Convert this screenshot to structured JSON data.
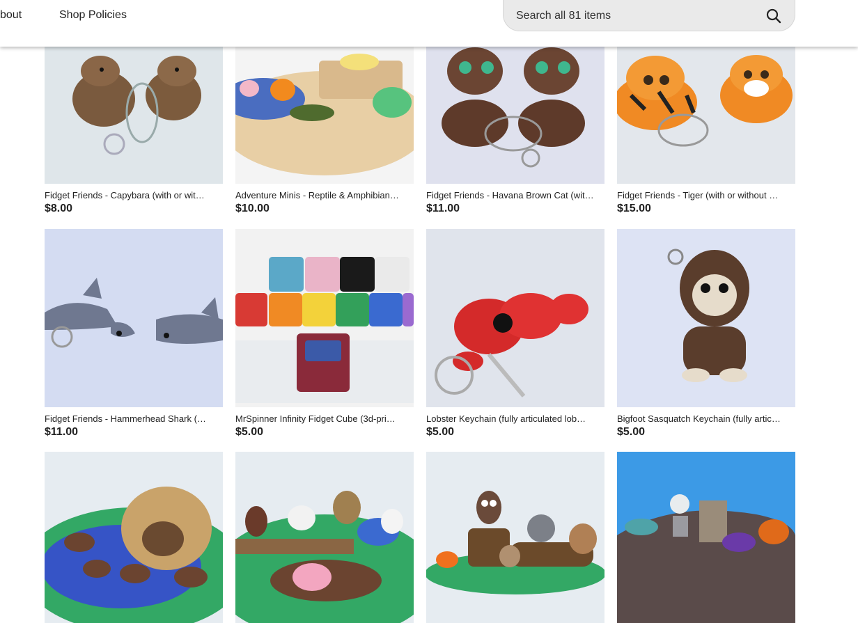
{
  "header": {
    "nav": [
      {
        "label": "bout"
      },
      {
        "label": "Shop Policies"
      }
    ],
    "search": {
      "placeholder": "Search all 81 items",
      "icon": "search-icon"
    }
  },
  "listings": [
    {
      "title": "Fidget Friends - Capybara (with or wit…",
      "price": "$8.00"
    },
    {
      "title": "Adventure Minis - Reptile & Amphibian…",
      "price": "$10.00"
    },
    {
      "title": "Fidget Friends - Havana Brown Cat (wit…",
      "price": "$11.00"
    },
    {
      "title": "Fidget Friends - Tiger (with or without …",
      "price": "$15.00"
    },
    {
      "title": "Fidget Friends - Hammerhead Shark (…",
      "price": "$11.00"
    },
    {
      "title": "MrSpinner Infinity Fidget Cube (3d-pri…",
      "price": "$5.00"
    },
    {
      "title": "Lobster Keychain (fully articulated lob…",
      "price": "$5.00"
    },
    {
      "title": "Bigfoot Sasquatch Keychain (fully artic…",
      "price": "$5.00"
    },
    {
      "title": "",
      "price": ""
    },
    {
      "title": "",
      "price": ""
    },
    {
      "title": "",
      "price": ""
    },
    {
      "title": "",
      "price": ""
    }
  ]
}
